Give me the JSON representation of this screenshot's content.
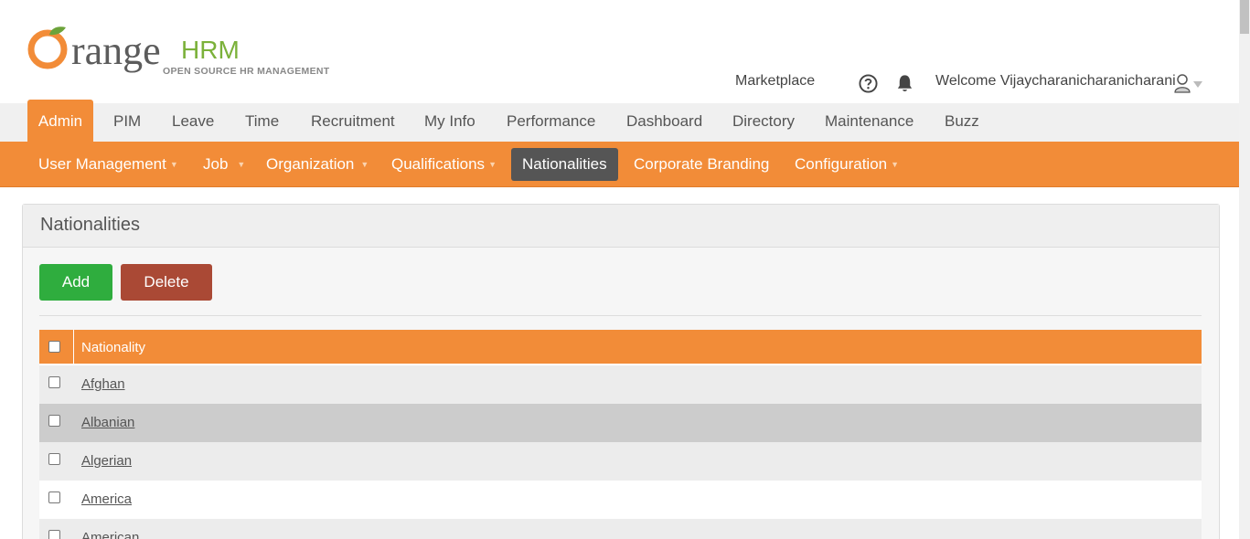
{
  "brand": {
    "word": "range",
    "hrm": "HRM",
    "tagline": "OPEN SOURCE HR MANAGEMENT"
  },
  "top": {
    "marketplace": "Marketplace",
    "welcome": "Welcome Vijaycharanicharanicharani"
  },
  "main_nav": [
    {
      "label": "Admin"
    },
    {
      "label": "PIM"
    },
    {
      "label": "Leave"
    },
    {
      "label": "Time"
    },
    {
      "label": "Recruitment"
    },
    {
      "label": "My Info"
    },
    {
      "label": "Performance"
    },
    {
      "label": "Dashboard"
    },
    {
      "label": "Directory"
    },
    {
      "label": "Maintenance"
    },
    {
      "label": "Buzz"
    }
  ],
  "sub_nav": [
    {
      "label": "User Management"
    },
    {
      "label": "Job"
    },
    {
      "label": "Organization"
    },
    {
      "label": "Qualifications"
    },
    {
      "label": "Nationalities"
    },
    {
      "label": "Corporate Branding"
    },
    {
      "label": "Configuration"
    }
  ],
  "panel": {
    "title": "Nationalities",
    "add_label": "Add",
    "delete_label": "Delete"
  },
  "table": {
    "header": "Nationality",
    "rows": [
      "Afghan",
      "Albanian",
      "Algerian",
      "America",
      "American"
    ]
  },
  "colors": {
    "accent": "#f28c38",
    "add": "#2fad3e",
    "delete": "#aa4935",
    "selected_sub": "#555555"
  }
}
